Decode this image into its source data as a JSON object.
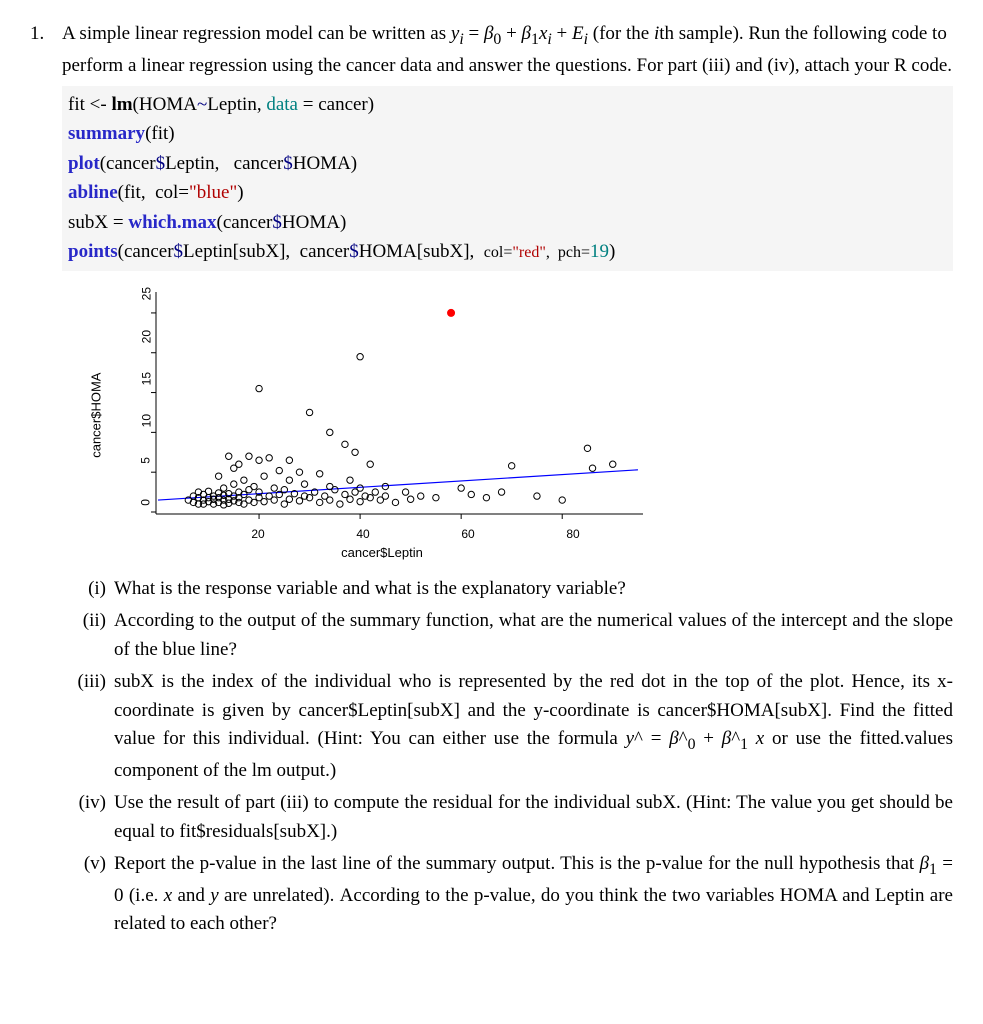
{
  "question": {
    "number": "1.",
    "intro_html": "A simple linear regression model can be written as <span class='math-i'>y<sub>i</sub></span> = <span class='math-i'>β</span><sub>0</sub> + <span class='math-i'>β</span><sub>1</sub><span class='math-i'>x<sub>i</sub></span> + <span class='math-i'>E<sub>i</sub></span> (for the <span class='math-i'>i</span>th sample). Run the following code to perform a linear regression using the cancer data and answer the questions. For part (iii) and (iv), attach your R code."
  },
  "code": {
    "l1_a": "fit <- ",
    "l1_b": "lm",
    "l1_c": "(HOMA",
    "l1_d": "~",
    "l1_e": "Leptin, ",
    "l1_f": "data",
    "l1_g": " = cancer)",
    "l2_a": "summary",
    "l2_b": "(fit)",
    "l3_a": "plot",
    "l3_b": "(cancer",
    "l3_c": "$",
    "l3_d": "Leptin,   cancer",
    "l3_e": "$",
    "l3_f": "HOMA)",
    "l4_a": "abline",
    "l4_b": "(fit,  col=",
    "l4_c": "\"blue\"",
    "l4_d": ")",
    "l5_a": "subX = ",
    "l5_b": "which.max",
    "l5_c": "(cancer",
    "l5_d": "$",
    "l5_e": "HOMA)",
    "l6_a": "points",
    "l6_b": "(cancer",
    "l6_c": "$",
    "l6_d": "Leptin[subX],  cancer",
    "l6_e": "$",
    "l6_f": "HOMA[subX],  ",
    "l6_g": "col=",
    "l6_h": "\"red\"",
    "l6_i": ",  pch=",
    "l6_j": "19",
    "l6_k": ")"
  },
  "plot": {
    "ylabel": "cancer$HOMA",
    "xlabel": "cancer$Leptin",
    "xticks": [
      "20",
      "40",
      "60",
      "80"
    ],
    "yticks": [
      "0",
      "5",
      "10",
      "15",
      "20",
      "25"
    ]
  },
  "chart_data": {
    "type": "scatter",
    "xlabel": "cancer$Leptin",
    "ylabel": "cancer$HOMA",
    "xlim": [
      0,
      95
    ],
    "ylim": [
      0,
      27
    ],
    "xticks": [
      20,
      40,
      60,
      80
    ],
    "yticks": [
      0,
      5,
      10,
      15,
      20,
      25
    ],
    "abline": {
      "intercept": 1.5,
      "slope": 0.04,
      "color": "blue"
    },
    "highlight_point": {
      "x": 58,
      "y": 25,
      "color": "red",
      "pch": 19
    },
    "points": [
      [
        6,
        1.5
      ],
      [
        7,
        2.0
      ],
      [
        7,
        1.2
      ],
      [
        8,
        1.8
      ],
      [
        8,
        1.0
      ],
      [
        8,
        2.5
      ],
      [
        9,
        1.5
      ],
      [
        9,
        2.2
      ],
      [
        9,
        1.0
      ],
      [
        10,
        1.8
      ],
      [
        10,
        1.3
      ],
      [
        10,
        2.6
      ],
      [
        11,
        1.0
      ],
      [
        11,
        2.0
      ],
      [
        11,
        1.6
      ],
      [
        12,
        1.2
      ],
      [
        12,
        2.4
      ],
      [
        12,
        1.8
      ],
      [
        12,
        4.5
      ],
      [
        13,
        0.9
      ],
      [
        13,
        2.1
      ],
      [
        13,
        1.5
      ],
      [
        13,
        3.0
      ],
      [
        14,
        1.6
      ],
      [
        14,
        1.1
      ],
      [
        14,
        2.3
      ],
      [
        14,
        7.0
      ],
      [
        15,
        1.4
      ],
      [
        15,
        2.0
      ],
      [
        15,
        3.5
      ],
      [
        15,
        5.5
      ],
      [
        16,
        1.2
      ],
      [
        16,
        2.5
      ],
      [
        16,
        1.8
      ],
      [
        16,
        6.0
      ],
      [
        17,
        1.0
      ],
      [
        17,
        2.2
      ],
      [
        17,
        4.0
      ],
      [
        18,
        1.5
      ],
      [
        18,
        2.8
      ],
      [
        18,
        7.0
      ],
      [
        19,
        1.2
      ],
      [
        19,
        3.2
      ],
      [
        20,
        1.8
      ],
      [
        20,
        2.5
      ],
      [
        20,
        6.5
      ],
      [
        20,
        15.5
      ],
      [
        21,
        1.3
      ],
      [
        21,
        4.5
      ],
      [
        22,
        2.0
      ],
      [
        22,
        6.8
      ],
      [
        23,
        1.5
      ],
      [
        23,
        3.0
      ],
      [
        24,
        2.2
      ],
      [
        24,
        5.2
      ],
      [
        25,
        1.0
      ],
      [
        25,
        2.8
      ],
      [
        26,
        1.6
      ],
      [
        26,
        4.0
      ],
      [
        26,
        6.5
      ],
      [
        27,
        2.3
      ],
      [
        28,
        1.4
      ],
      [
        28,
        5.0
      ],
      [
        29,
        2.0
      ],
      [
        29,
        3.5
      ],
      [
        30,
        1.8
      ],
      [
        30,
        12.5
      ],
      [
        31,
        2.5
      ],
      [
        32,
        1.2
      ],
      [
        32,
        4.8
      ],
      [
        33,
        2.0
      ],
      [
        34,
        1.5
      ],
      [
        34,
        3.2
      ],
      [
        34,
        10.0
      ],
      [
        35,
        2.8
      ],
      [
        36,
        1.0
      ],
      [
        37,
        2.2
      ],
      [
        37,
        8.5
      ],
      [
        38,
        1.6
      ],
      [
        38,
        4.0
      ],
      [
        39,
        2.5
      ],
      [
        39,
        7.5
      ],
      [
        40,
        1.3
      ],
      [
        40,
        3.0
      ],
      [
        40,
        19.5
      ],
      [
        41,
        2.0
      ],
      [
        42,
        1.8
      ],
      [
        42,
        6.0
      ],
      [
        43,
        2.5
      ],
      [
        44,
        1.5
      ],
      [
        45,
        2.0
      ],
      [
        45,
        3.2
      ],
      [
        47,
        1.2
      ],
      [
        49,
        2.5
      ],
      [
        50,
        1.6
      ],
      [
        52,
        2.0
      ],
      [
        55,
        1.8
      ],
      [
        58,
        25.0
      ],
      [
        60,
        3.0
      ],
      [
        62,
        2.2
      ],
      [
        65,
        1.8
      ],
      [
        68,
        2.5
      ],
      [
        70,
        5.8
      ],
      [
        75,
        2.0
      ],
      [
        80,
        1.5
      ],
      [
        85,
        8.0
      ],
      [
        86,
        5.5
      ],
      [
        90,
        6.0
      ]
    ]
  },
  "subparts": {
    "i_label": "(i)",
    "i_body": "What is the response variable and what is the explanatory variable?",
    "ii_label": "(ii)",
    "ii_body": "According to the output of the summary function, what are the numerical values of the intercept and the slope of the blue line?",
    "iii_label": "(iii)",
    "iii_body_html": "subX is the index of the individual who is represented by the red dot in the top of the plot. Hence, its x-coordinate is given by cancer$Leptin[subX] and the y-coordinate is cancer$HOMA[subX]. Find the fitted value for this individual. (Hint: You can either use the formula <span class='math-i'>y</span>^ = <span class='math-i'>β</span>^<sub>0</sub> + <span class='math-i'>β</span>^<sub>1</sub> <span class='math-i'>x</span> or use the fitted.values component of the lm output.)",
    "iv_label": "(iv)",
    "iv_body": "Use the result of part (iii) to compute the residual for the individual subX. (Hint: The value you get should be equal to fit$residuals[subX].)",
    "v_label": "(v)",
    "v_body_html": "Report the p-value in the last line of the summary output. This is the p-value for the null hypothesis that <span class='math-i'>β</span><sub>1</sub> = 0 (i.e. <span class='math-i'>x</span> and <span class='math-i'>y</span> are unrelated). According to the p-value, do you think the two variables HOMA and Leptin are related to each other?"
  }
}
